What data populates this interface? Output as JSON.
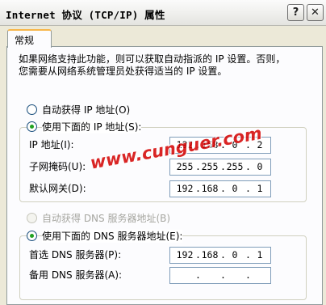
{
  "window": {
    "title": "Internet 协议 (TCP/IP) 属性",
    "help_glyph": "?",
    "close_glyph": "✕"
  },
  "tabs": [
    {
      "label": "常规",
      "selected": true
    }
  ],
  "description": {
    "line1": "如果网络支持此功能，则可以获取自动指派的 IP 设置。否则，",
    "line2": "您需要从网络系统管理员处获得适当的 IP 设置。"
  },
  "ip_mode": {
    "auto_label": "自动获得 IP 地址(O)",
    "manual_label": "使用下面的 IP 地址(S):",
    "selected": "manual"
  },
  "ip_fields": [
    {
      "label": "IP 地址(I):",
      "octets": [
        "192",
        "168",
        "0",
        "2"
      ]
    },
    {
      "label": "子网掩码(U):",
      "octets": [
        "255",
        "255",
        "255",
        "0"
      ]
    },
    {
      "label": "默认网关(D):",
      "octets": [
        "192",
        "168",
        "0",
        "1"
      ]
    }
  ],
  "dns_mode": {
    "auto_label": "自动获得 DNS 服务器地址(B)",
    "auto_enabled": false,
    "manual_label": "使用下面的 DNS 服务器地址(E):",
    "selected": "manual"
  },
  "dns_fields": [
    {
      "label": "首选 DNS 服务器(P):",
      "octets": [
        "192",
        "168",
        "0",
        "1"
      ]
    },
    {
      "label": "备用 DNS 服务器(A):",
      "octets": [
        "",
        "",
        "",
        ""
      ]
    }
  ],
  "watermark": {
    "text": "www.cunguer.com"
  },
  "colors": {
    "dialog_bg": "#ece9d8",
    "panel_bg": "#fcfcfe",
    "tab_highlight": "#f7b64a",
    "radio_check": "#21a121",
    "input_border": "#7f9db9",
    "watermark": "#d40000"
  },
  "icons": [
    "help-icon",
    "close-icon"
  ]
}
